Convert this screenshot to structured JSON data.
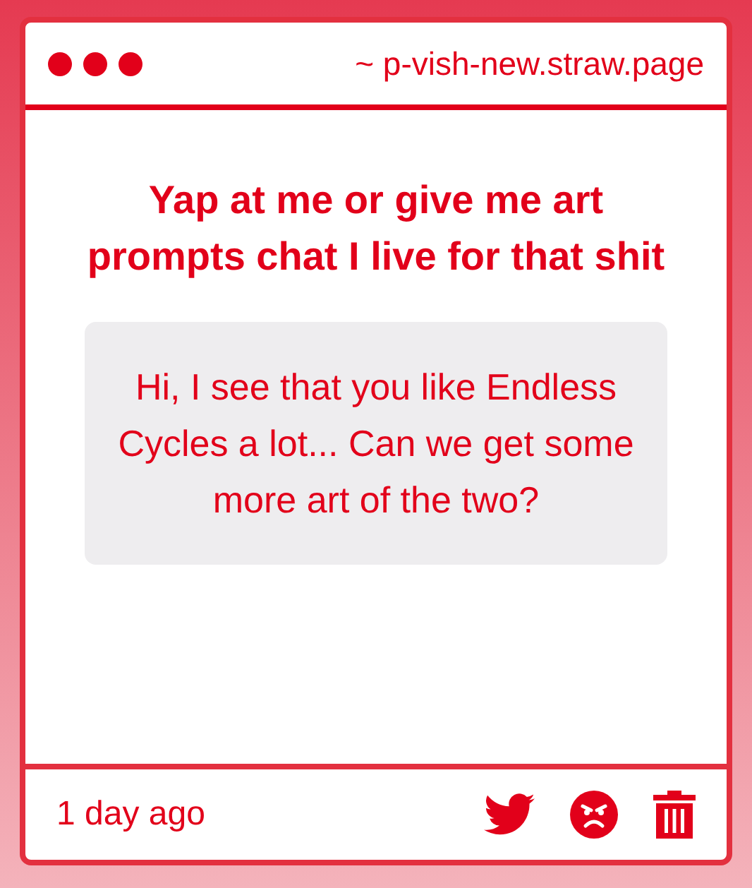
{
  "header": {
    "address": "~ p-vish-new.straw.page"
  },
  "question": {
    "title": "Yap at me or give me art prompts chat I live for that shit",
    "message": "Hi, I see that you like Endless Cycles a lot... Can we get some more art of the two?"
  },
  "footer": {
    "time": "1 day ago"
  }
}
